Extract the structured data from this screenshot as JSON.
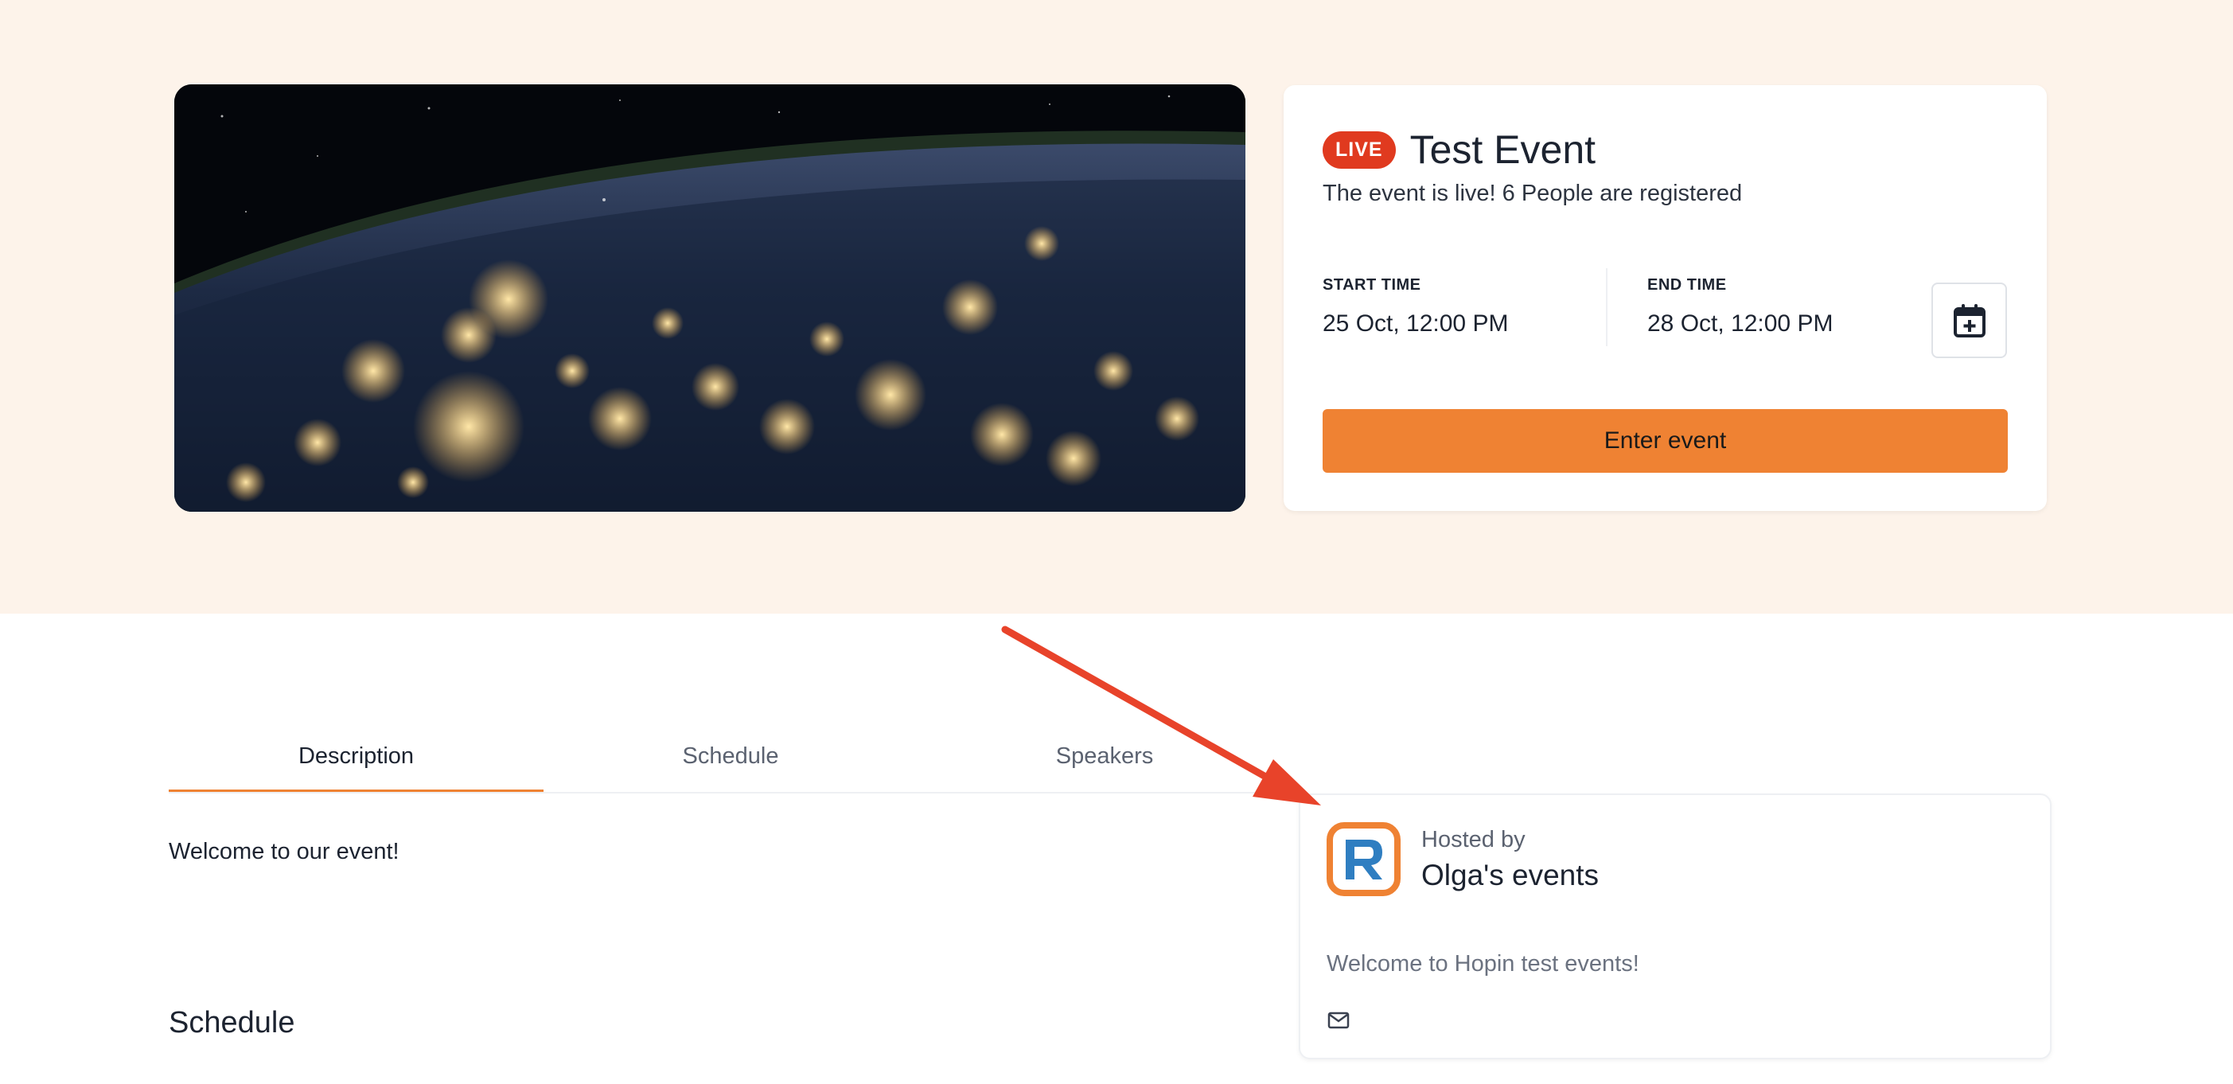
{
  "hero": {
    "image_alt": "Night view of Earth from space"
  },
  "event": {
    "badge": "LIVE",
    "title": "Test Event",
    "status": "The event is live! 6 People are registered",
    "start_label": "START TIME",
    "start_value": "25 Oct, 12:00 PM",
    "end_label": "END TIME",
    "end_value": "28 Oct, 12:00 PM",
    "enter_label": "Enter event",
    "calendar_icon": "calendar-plus-icon"
  },
  "tabs": [
    {
      "label": "Description",
      "active": true
    },
    {
      "label": "Schedule",
      "active": false
    },
    {
      "label": "Speakers",
      "active": false
    }
  ],
  "description": {
    "welcome": "Welcome to our event!",
    "schedule_heading": "Schedule"
  },
  "host": {
    "hosted_by": "Hosted by",
    "name": "Olga's events",
    "description": "Welcome to Hopin test events!",
    "mail_icon": "mail-icon"
  },
  "colors": {
    "accent": "#ef8233",
    "live": "#e03a1f",
    "hero_bg": "#fdf3ea",
    "annotation": "#e8432a",
    "logo_blue": "#2f7ec1"
  }
}
